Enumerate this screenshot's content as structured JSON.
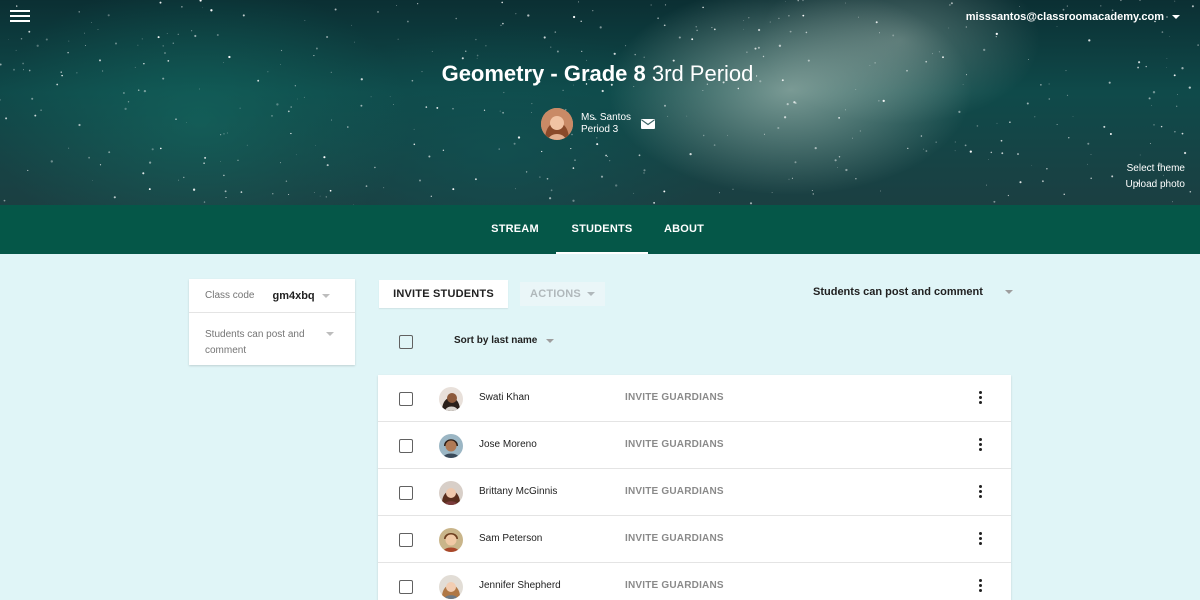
{
  "header": {
    "account_email": "misssantos@classroomacademy.com",
    "class_name": "Geometry - Grade 8",
    "class_section": "3rd Period",
    "teacher_name": "Ms. Santos",
    "teacher_period": "Period 3",
    "select_theme": "Select theme",
    "upload_photo": "Upload photo"
  },
  "tabs": [
    {
      "label": "STREAM",
      "active": false
    },
    {
      "label": "STUDENTS",
      "active": true
    },
    {
      "label": "ABOUT",
      "active": false
    }
  ],
  "sidebar": {
    "class_code_label": "Class code",
    "class_code_value": "gm4xbq",
    "permission_label": "Students can post and comment"
  },
  "toolbar": {
    "invite_students": "INVITE STUDENTS",
    "actions": "ACTIONS",
    "permission_select": "Students can post and comment",
    "sort_label": "Sort by last name"
  },
  "students": [
    {
      "name": "Swati Khan",
      "action": "INVITE GUARDIANS"
    },
    {
      "name": "Jose Moreno",
      "action": "INVITE GUARDIANS"
    },
    {
      "name": "Brittany McGinnis",
      "action": "INVITE GUARDIANS"
    },
    {
      "name": "Sam Peterson",
      "action": "INVITE GUARDIANS"
    },
    {
      "name": "Jennifer Shepherd",
      "action": "INVITE GUARDIANS"
    }
  ],
  "colors": {
    "tab_bar": "#055748",
    "page_background": "#e0f5f7",
    "card_background": "#ffffff"
  },
  "icons": {
    "menu": "hamburger-menu-icon",
    "mail": "mail-icon",
    "more": "more-vert-icon",
    "dropdown": "dropdown-arrow-icon"
  }
}
